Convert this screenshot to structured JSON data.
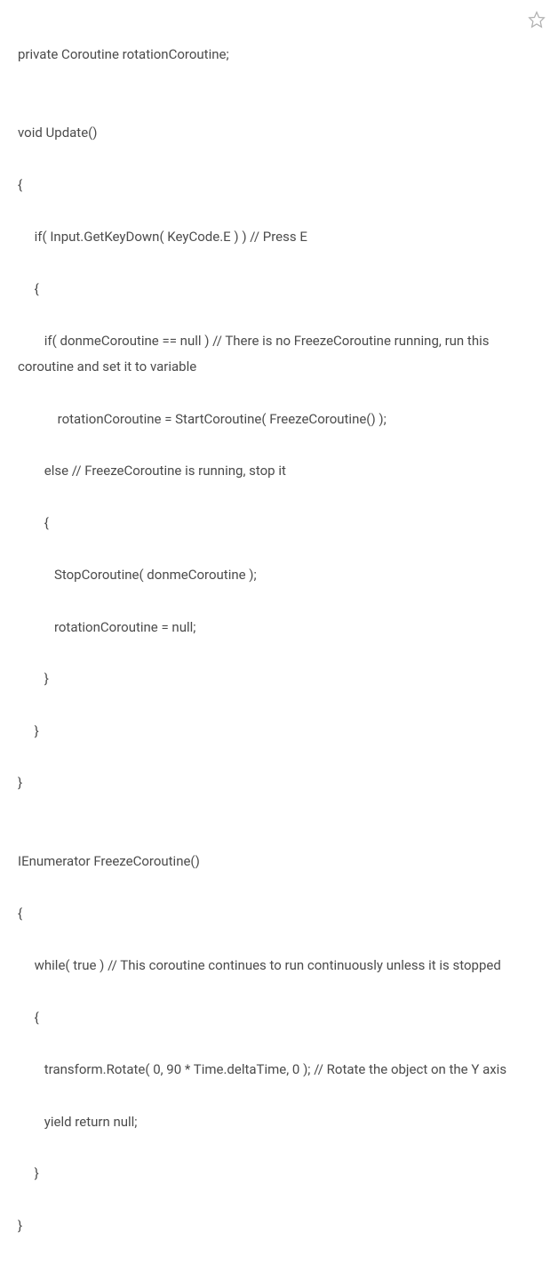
{
  "code": {
    "line1": "private Coroutine rotationCoroutine;",
    "line2": "",
    "line3": "void Update()",
    "line4": "{",
    "line5": "     if( Input.GetKeyDown( KeyCode.E ) ) // Press E",
    "line6": "     {",
    "line7": "        if( donmeCoroutine == null ) // There is no FreezeCoroutine running, run this coroutine and set it to variable",
    "line8": "            rotationCoroutine = StartCoroutine( FreezeCoroutine() );",
    "line9": "        else // FreezeCoroutine is running, stop it",
    "line10": "        {",
    "line11": "           StopCoroutine( donmeCoroutine );",
    "line12": "           rotationCoroutine = null;",
    "line13": "        }",
    "line14": "     }",
    "line15": "}",
    "line16": "",
    "line17": "IEnumerator FreezeCoroutine()",
    "line18": "{",
    "line19": "     while( true ) // This coroutine continues to run continuously unless it is stopped",
    "line20": "     {",
    "line21": "        transform.Rotate( 0, 90 * Time.deltaTime, 0 ); // Rotate the object on the Y axis",
    "line22": "        yield return null;",
    "line23": "     }",
    "line24": "}"
  }
}
